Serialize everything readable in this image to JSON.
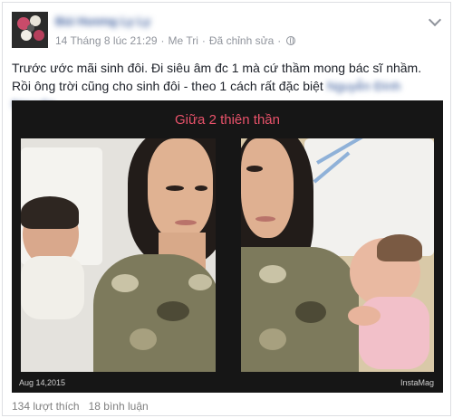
{
  "post": {
    "author_name": "Bùi Hương Ly Ly",
    "timestamp": "14 Tháng 8 lúc 21:29",
    "location": "Me Tri",
    "edited_label": "Đã chỉnh sửa",
    "text_main": "Trước ước mãi sinh đôi. Đi siêu âm đc 1 mà cứ thầm mong bác sĩ nhầm. Rồi ông trời cũng cho sinh đôi - theo 1 cách rất đặc biệt",
    "text_tag": "Nguyễn Đình Nguyên"
  },
  "photo": {
    "title": "Giữa 2 thiên thần",
    "date": "Aug 14,2015",
    "brand": "InstaMag"
  },
  "stats": {
    "likes": "134 lượt thích",
    "comments": "18 bình luận"
  },
  "icons": {
    "privacy": "globe-icon",
    "options": "chevron-down-icon"
  }
}
